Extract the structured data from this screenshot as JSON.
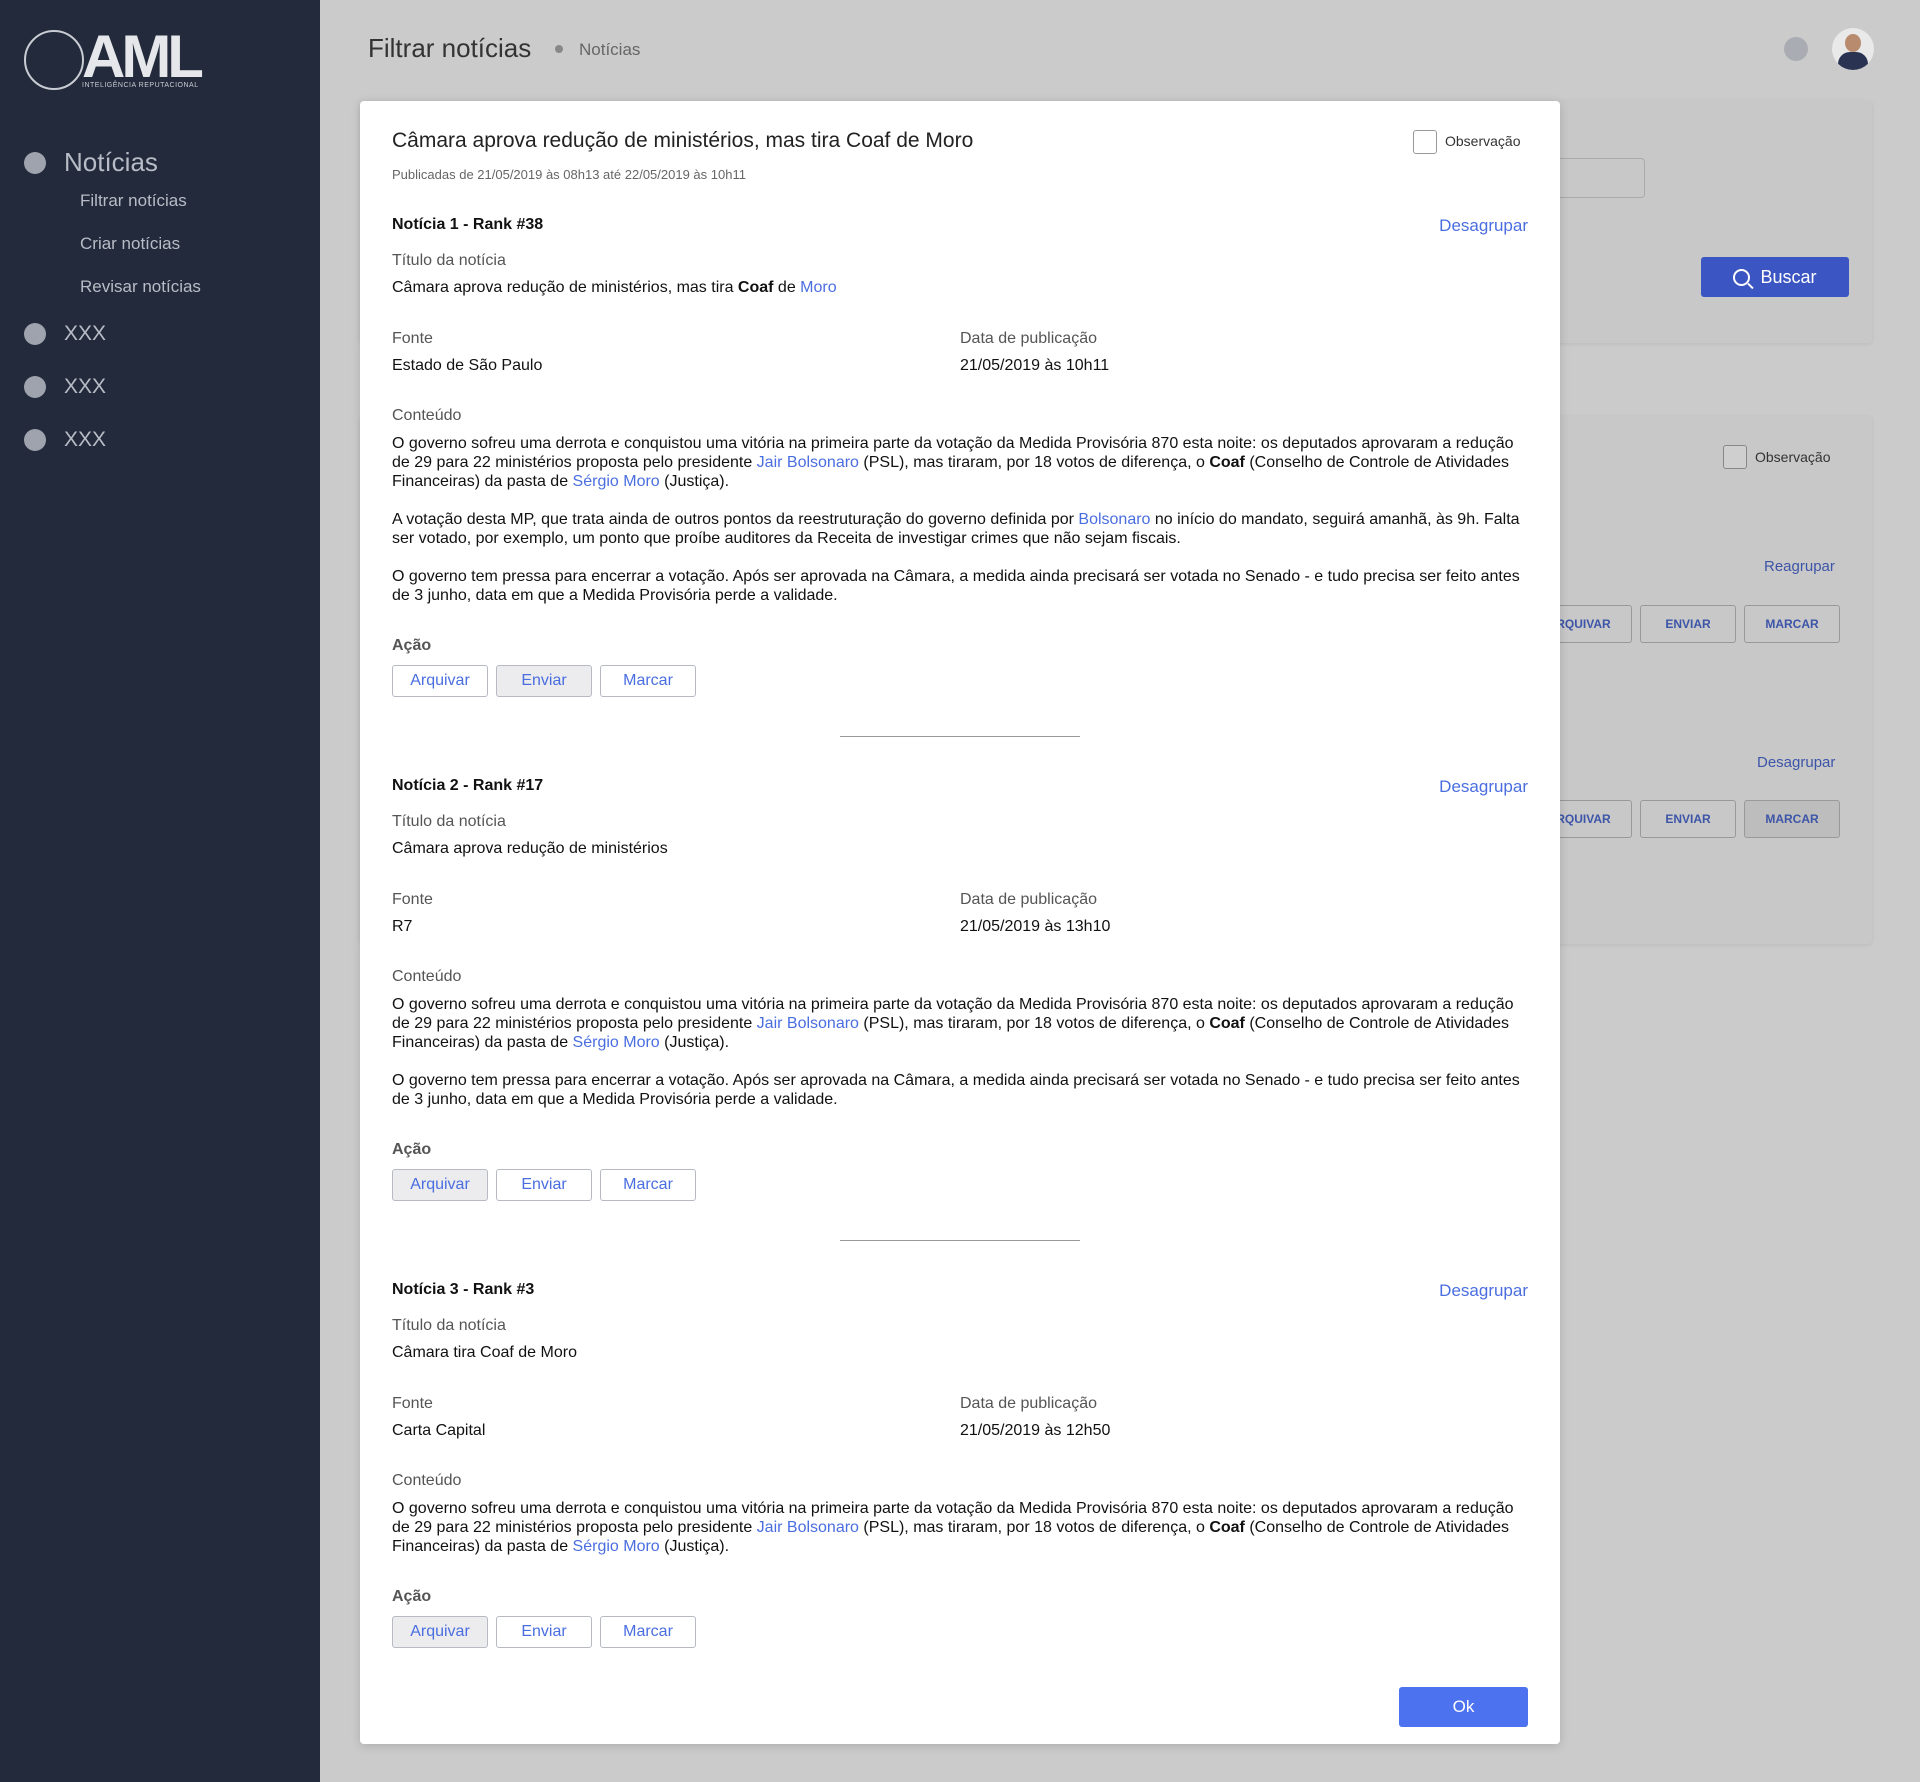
{
  "sidebar": {
    "logo_text": "AML",
    "logo_subtitle": "INTELIGÊNCIA REPUTACIONAL",
    "sections": [
      {
        "label": "Notícias",
        "items": [
          "Filtrar notícias",
          "Criar notícias",
          "Revisar notícias"
        ]
      },
      {
        "label": "XXX"
      },
      {
        "label": "XXX"
      },
      {
        "label": "XXX"
      }
    ]
  },
  "header": {
    "title": "Filtrar notícias",
    "breadcrumb": "Notícias"
  },
  "background": {
    "search_button": "Buscar",
    "observation_label": "Observação",
    "regroup_link": "Reagrupar",
    "ungroup_link": "Desagrupar",
    "row1": [
      "RQUIVAR",
      "ENVIAR",
      "MARCAR"
    ],
    "row2": [
      "RQUIVAR",
      "ENVIAR",
      "MARCAR"
    ]
  },
  "modal": {
    "title": "Câmara aprova redução de ministérios, mas tira Coaf de Moro",
    "subtitle": "Publicadas de 21/05/2019 às 08h13 até 22/05/2019 às 10h11",
    "observation_label": "Observação",
    "labels": {
      "title": "Título da notícia",
      "source": "Fonte",
      "date": "Data de publicação",
      "content": "Conteúdo",
      "action": "Ação",
      "ungroup": "Desagrupar"
    },
    "buttons": {
      "archive": "Arquivar",
      "send": "Enviar",
      "mark": "Marcar"
    },
    "ok": "Ok",
    "news": [
      {
        "heading": "Notícia 1 - Rank #38",
        "title_parts": [
          "Câmara aprova redução de ministérios, mas tira ",
          "Coaf",
          " de ",
          "Moro"
        ],
        "source": "Estado de São Paulo",
        "date": "21/05/2019 às 10h11",
        "paragraphs": [
          [
            "O governo sofreu uma derrota e conquistou uma vitória na primeira parte da votação da Medida Provisória 870 esta noite: os deputados aprovaram a redução de 29 para 22 ministérios proposta pelo presidente ",
            "Jair Bolsonaro",
            " (PSL), mas tiraram, por 18 votos de diferença, o ",
            "Coaf",
            " (Conselho de Controle de Atividades Financeiras) da pasta de ",
            "Sérgio Moro",
            " (Justiça)."
          ],
          [
            "A votação desta MP, que trata ainda de outros pontos da reestruturação do governo definida por ",
            "Bolsonaro",
            " no início do mandato, seguirá amanhã, às 9h. Falta ser votado, por exemplo, um ponto que proíbe auditores da Receita de investigar crimes que não sejam fiscais."
          ],
          [
            "O governo tem pressa para encerrar a votação. Após ser aprovada na Câmara, a medida ainda precisará ser votada no Senado - e tudo precisa ser feito antes de 3 junho, data em que a Medida Provisória perde a validade."
          ]
        ]
      },
      {
        "heading": "Notícia 2 - Rank #17",
        "title": "Câmara aprova redução de ministérios",
        "source": "R7",
        "date": "21/05/2019 às 13h10",
        "paragraphs": [
          [
            "O governo sofreu uma derrota e conquistou uma vitória na primeira parte da votação da Medida Provisória 870 esta noite: os deputados aprovaram a redução de 29 para 22 ministérios proposta pelo presidente ",
            "Jair Bolsonaro",
            " (PSL), mas tiraram, por 18 votos de diferença, o ",
            "Coaf",
            " (Conselho de Controle de Atividades Financeiras) da pasta de ",
            "Sérgio Moro",
            " (Justiça)."
          ],
          [
            "O governo tem pressa para encerrar a votação. Após ser aprovada na Câmara, a medida ainda precisará ser votada no Senado - e tudo precisa ser feito antes de 3 junho, data em que a Medida Provisória perde a validade."
          ]
        ]
      },
      {
        "heading": "Notícia 3 - Rank #3",
        "title": "Câmara tira Coaf de Moro",
        "source": "Carta Capital",
        "date": "21/05/2019 às 12h50",
        "paragraphs": [
          [
            "O governo sofreu uma derrota e conquistou uma vitória na primeira parte da votação da Medida Provisória 870 esta noite: os deputados aprovaram a redução de 29 para 22 ministérios proposta pelo presidente ",
            "Jair Bolsonaro",
            " (PSL), mas tiraram, por 18 votos de diferença, o ",
            "Coaf",
            " (Conselho de Controle de Atividades Financeiras) da pasta de ",
            "Sérgio Moro",
            " (Justiça)."
          ]
        ]
      }
    ]
  }
}
